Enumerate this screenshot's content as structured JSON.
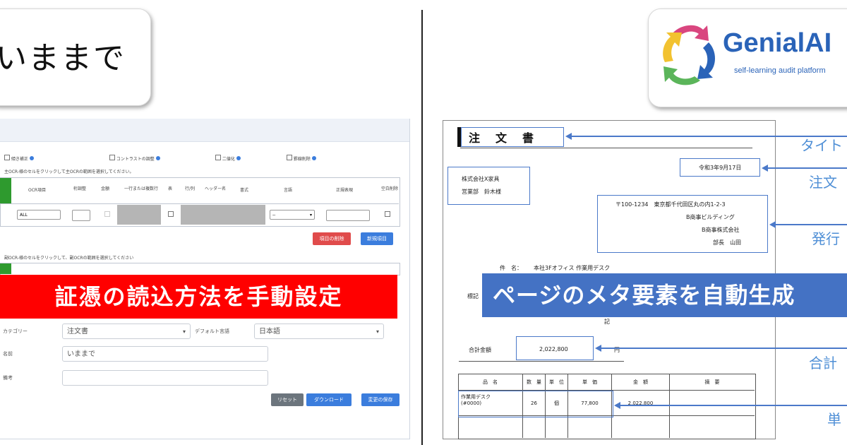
{
  "left_callout": {
    "text": "いままで"
  },
  "logo": {
    "name": "GenialAI",
    "tagline": "self-learning audit platform"
  },
  "settings": {
    "options": [
      "傾き補正",
      "コントラストの調整",
      "二値化",
      "罫線削除"
    ],
    "instruction_1": "主OCR-様のセルをクリックして主OCRの範囲を選択してください。",
    "instruction_2": "副OCR-様のセルをクリックして、副OCRの範囲を選択してください",
    "table_headers": [
      "OCR項目",
      "桁調整",
      "金額",
      "一行または複数行",
      "表",
      "行/列",
      "ヘッダー名",
      "書式",
      "言語",
      "正規表現",
      "空白削除"
    ],
    "row_value": "ALL",
    "row_select": "--",
    "delete_button": "項目の削除",
    "new_button": "新規項目",
    "form": {
      "category_label": "カテゴリー",
      "category_value": "注文書",
      "default_lang_label": "デフォルト言語",
      "default_lang_value": "日本語",
      "name_label": "名前",
      "name_value": "いままで",
      "note_label": "備考",
      "note_value": ""
    },
    "reset_button": "リセット",
    "download_button": "ダウンロード",
    "save_button": "変更の保存"
  },
  "red_banner": "証憑の読込方法を手動設定",
  "blue_banner": "ページのメタ要素を自動生成",
  "document": {
    "title": "注　文　書",
    "date": "令和3年9月17日",
    "recipient_1": "株式会社X家具",
    "recipient_2": "営業部　鈴木様",
    "issuer_1": "〒100-1234　東京都千代田区丸の内1-2-3",
    "issuer_2": "B商事ビルディング",
    "issuer_3": "B商事株式会社",
    "issuer_4": "部長　山田",
    "subject_label": "件　名：",
    "subject_value": "本社3Fオフィス 作業用デスク",
    "side_1": "標記",
    "side_2": "記",
    "total_label": "合計金額",
    "total_value": "2,022,800",
    "total_unit": "円",
    "table_headers": [
      "品　名",
      "数　量",
      "単　位",
      "単　価",
      "金　額",
      "摘　要"
    ],
    "row_item": "作業用デスク",
    "row_item_sub": "(#0000)",
    "row_qty": "26",
    "row_unit": "個",
    "row_price": "77,800",
    "row_amount": "2,022,800"
  },
  "annotations": [
    "タイト",
    "注文",
    "発行",
    "合計",
    "単"
  ],
  "colors": {
    "accent_blue": "#4472c4",
    "red": "#ff0000",
    "logo_blue": "#2a63b8"
  }
}
